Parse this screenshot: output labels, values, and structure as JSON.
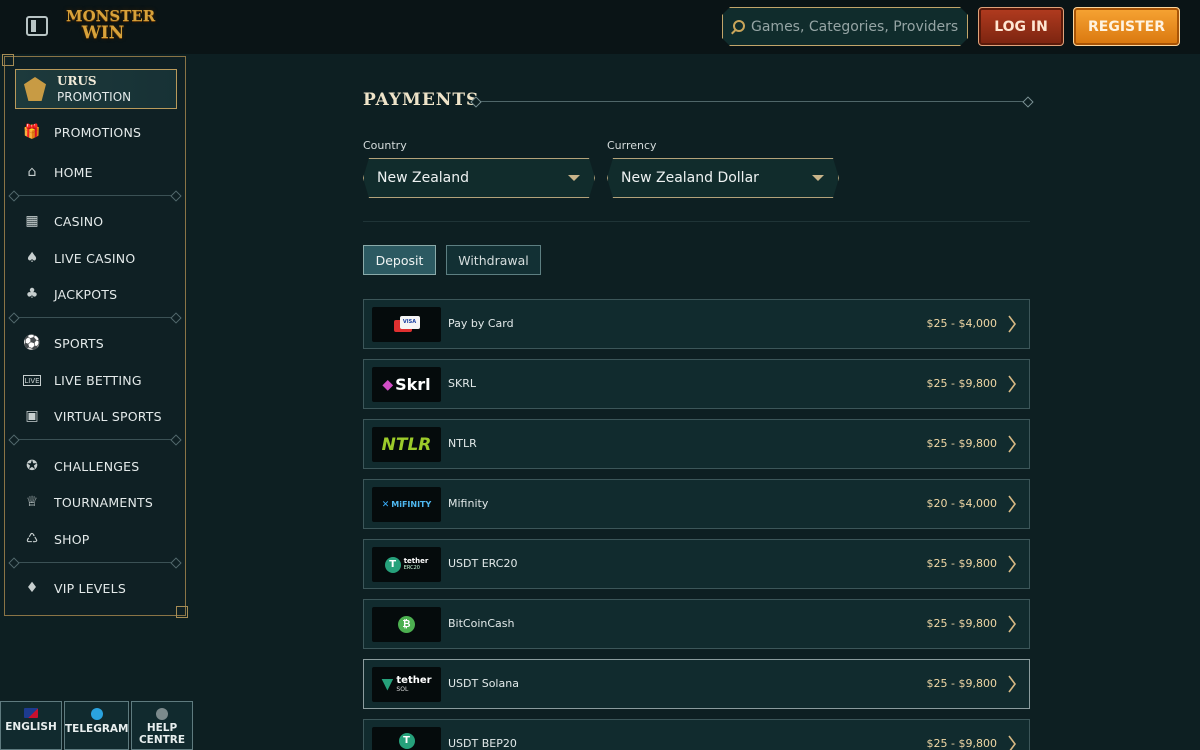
{
  "header": {
    "logo_line1": "MONSTER",
    "logo_line2": "WIN",
    "search_placeholder": "Games, Categories, Providers",
    "login_label": "LOG IN",
    "register_label": "REGISTER"
  },
  "sidebar": {
    "promo": {
      "title": "URUS",
      "subtitle": "PROMOTION"
    },
    "items": [
      {
        "label": "PROMOTIONS",
        "icon": "gift-icon"
      },
      {
        "label": "HOME",
        "icon": "home-icon"
      },
      {
        "label": "CASINO",
        "icon": "slot-machine-icon"
      },
      {
        "label": "LIVE CASINO",
        "icon": "cards-icon"
      },
      {
        "label": "JACKPOTS",
        "icon": "clover-icon"
      },
      {
        "label": "SPORTS",
        "icon": "ball-icon"
      },
      {
        "label": "LIVE BETTING",
        "icon": "live-icon"
      },
      {
        "label": "VIRTUAL SPORTS",
        "icon": "virtual-sports-icon"
      },
      {
        "label": "CHALLENGES",
        "icon": "medal-icon"
      },
      {
        "label": "TOURNAMENTS",
        "icon": "trophy-icon"
      },
      {
        "label": "SHOP",
        "icon": "basket-icon"
      },
      {
        "label": "VIP LEVELS",
        "icon": "diamond-icon"
      }
    ]
  },
  "footer_buttons": {
    "language": "ENGLISH",
    "telegram": "TELEGRAM",
    "help_line1": "HELP",
    "help_line2": "CENTRE"
  },
  "main": {
    "title": "PAYMENTS",
    "country_label": "Country",
    "country_value": "New Zealand",
    "currency_label": "Currency",
    "currency_value": "New Zealand Dollar",
    "tabs": {
      "deposit": "Deposit",
      "withdrawal": "Withdrawal"
    },
    "methods": [
      {
        "name": "Pay by Card",
        "range": "$25 - $4,000",
        "logo": "VISA"
      },
      {
        "name": "SKRL",
        "range": "$25 - $9,800",
        "logo": "Skrl"
      },
      {
        "name": "NTLR",
        "range": "$25 - $9,800",
        "logo": "NTLR"
      },
      {
        "name": "Mifinity",
        "range": "$20 - $4,000",
        "logo": "MiFINITY"
      },
      {
        "name": "USDT ERC20",
        "range": "$25 - $9,800",
        "logo": "tether",
        "logo_sub": "ERC20"
      },
      {
        "name": "BitCoinCash",
        "range": "$25 - $9,800",
        "logo": ""
      },
      {
        "name": "USDT Solana",
        "range": "$25 - $9,800",
        "logo": "tether",
        "logo_sub": "SOL"
      },
      {
        "name": "USDT BEP20",
        "range": "$25 - $9,800",
        "logo": ""
      }
    ]
  },
  "colors": {
    "background": "#0d1f22",
    "gold": "#c9a55a",
    "login": "#b23b1f",
    "register": "#f29b2d"
  }
}
